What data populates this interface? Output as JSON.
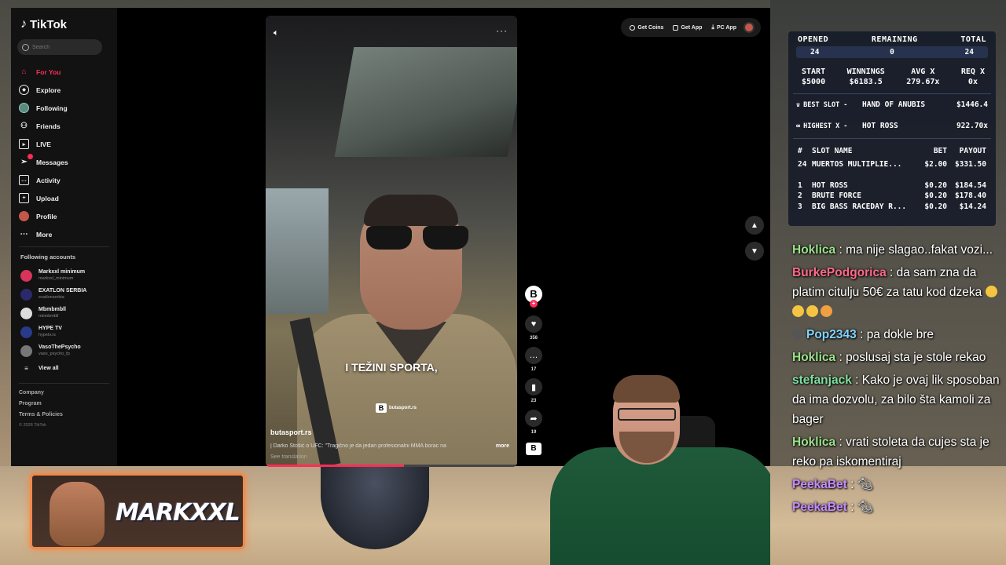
{
  "tiktok": {
    "logo": "TikTok",
    "search_placeholder": "Search",
    "nav": [
      {
        "label": "For You",
        "icon": "home-icon"
      },
      {
        "label": "Explore",
        "icon": "compass-icon"
      },
      {
        "label": "Following",
        "icon": "avatar-icon"
      },
      {
        "label": "Friends",
        "icon": "friends-icon"
      },
      {
        "label": "LIVE",
        "icon": "live-icon"
      },
      {
        "label": "Messages",
        "icon": "messages-icon"
      },
      {
        "label": "Activity",
        "icon": "activity-icon"
      },
      {
        "label": "Upload",
        "icon": "upload-icon"
      },
      {
        "label": "Profile",
        "icon": "profile-avatar-icon"
      },
      {
        "label": "More",
        "icon": "more-icon"
      }
    ],
    "following_title": "Following accounts",
    "following": [
      {
        "name": "Markxxl minimum",
        "handle": "markxxl_minimum",
        "color": "#d8345a"
      },
      {
        "name": "EXATLON SERBIA",
        "handle": "exatlonserbia",
        "color": "#2a2a6a"
      },
      {
        "name": "Mbmbmbll",
        "handle": "mbmbmbll",
        "color": "#dddddd"
      },
      {
        "name": "HYPE TV",
        "handle": "hypetv.rs",
        "color": "#2a3a8a"
      },
      {
        "name": "VasoThePsycho",
        "handle": "vaso_psycho_fp",
        "color": "#777777"
      }
    ],
    "view_all": "View all",
    "footer": [
      "Company",
      "Program",
      "Terms & Policies"
    ],
    "copyright": "© 2026 TikTok",
    "topbar": [
      "Get Coins",
      "Get App",
      "PC App"
    ],
    "video": {
      "caption": "I TEŽINI SPORTA,",
      "watermark": "butasport.rs",
      "author": "butasport.rs",
      "description": "| Darko Stošić o UFC: \"Tragično je da jedan profesionalni MMA borac na",
      "more": "more",
      "see_translation": "See translation",
      "progress_fraction": 0.55
    },
    "actions": {
      "likes": "356",
      "comments": "17",
      "saves": "23",
      "shares": "19"
    }
  },
  "stats": {
    "headers3": [
      "OPENED",
      "REMAINING",
      "TOTAL"
    ],
    "values3": [
      "24",
      "0",
      "24"
    ],
    "headers4": [
      "START",
      "WINNINGS",
      "AVG X",
      "REQ X"
    ],
    "values4": [
      "$5000",
      "$6183.5",
      "279.67x",
      "0x"
    ],
    "best_slot": {
      "label": "BEST SLOT -",
      "name": "HAND OF ANUBIS",
      "value": "$1446.4"
    },
    "highest_x": {
      "label": "HIGHEST X -",
      "name": "HOT ROSS",
      "value": "922.70x"
    },
    "slot_headers": [
      "#",
      "SLOT NAME",
      "BET",
      "PAYOUT"
    ],
    "current": {
      "num": "24",
      "name": "MUERTOS MULTIPLIE...",
      "bet": "$2.00",
      "payout": "$331.50"
    },
    "top": [
      {
        "num": "1",
        "name": "HOT ROSS",
        "bet": "$0.20",
        "payout": "$184.54"
      },
      {
        "num": "2",
        "name": "BRUTE FORCE",
        "bet": "$0.20",
        "payout": "$178.40"
      },
      {
        "num": "3",
        "name": "BIG BASS RACEDAY R...",
        "bet": "$0.20",
        "payout": "$14.24"
      }
    ]
  },
  "chat": [
    {
      "user": "Hoklica",
      "color": "#9be28a",
      "text": "ma nije slagao..fakat vozi..."
    },
    {
      "user": "BurkePodgorica",
      "color": "#ff6a8a",
      "text": "da sam zna da platim citulju 50€ za tatu kod dzeka",
      "emojis": 4
    },
    {
      "user": "Pop2343",
      "color": "#7fd4ff",
      "text": "pa dokle bre"
    },
    {
      "user": "Hoklica",
      "color": "#9be28a",
      "text": "poslusaj sta je stole rekao"
    },
    {
      "user": "stefanjack",
      "color": "#7fe0a0",
      "text": "Kako je ovaj lik sposoban da ima dozvolu, za bilo šta kamoli za bager"
    },
    {
      "user": "Hoklica",
      "color": "#9be28a",
      "text": "vrati stoleta da cujes sta je reko pa iskomentiraj"
    },
    {
      "user": "PeekaBet",
      "color": "#c58aff",
      "text": ""
    },
    {
      "user": "PeekaBet",
      "color": "#c58aff",
      "text": ""
    }
  ],
  "banner": {
    "text": "MARKXXL"
  },
  "colors": {
    "tiktok_red": "#fe2c55",
    "banner_glow": "#f08a4a"
  }
}
